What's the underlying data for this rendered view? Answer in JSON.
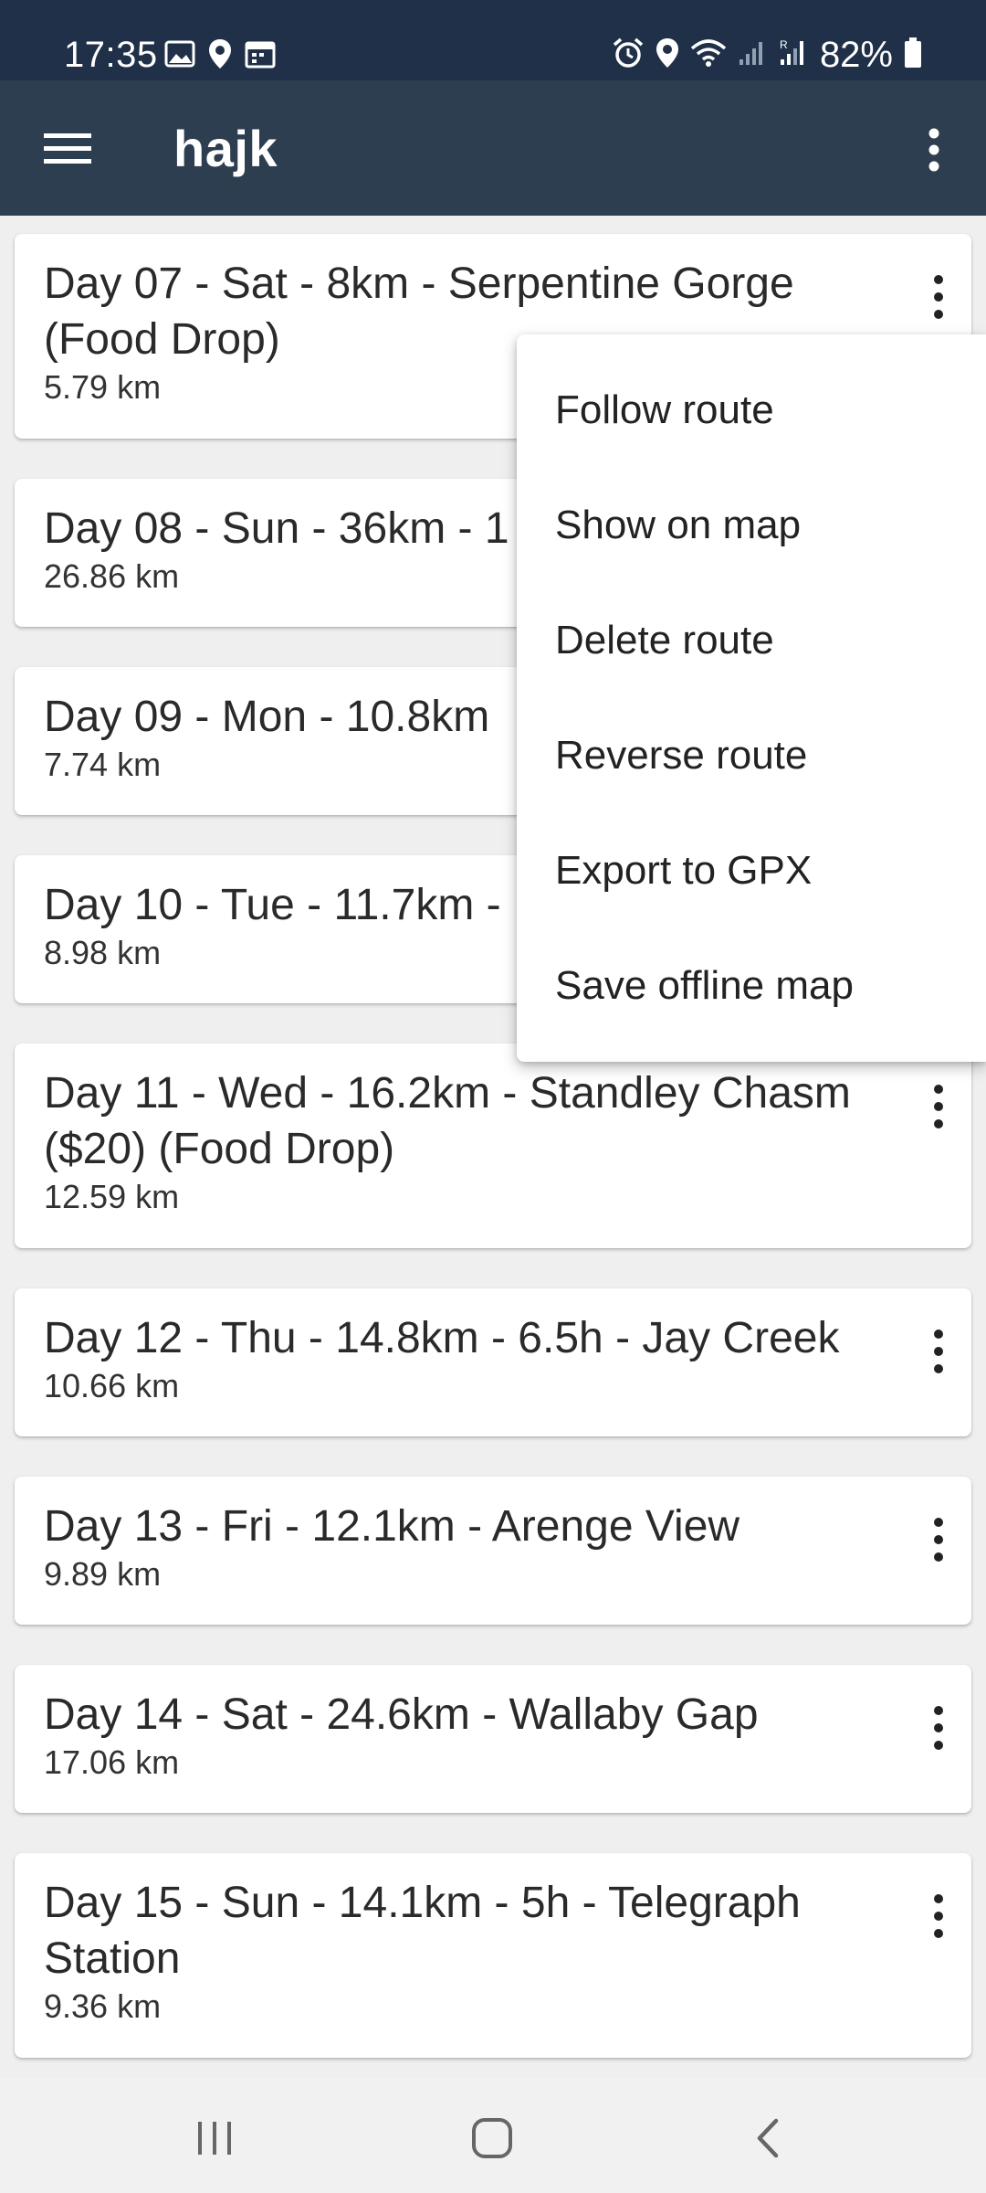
{
  "status_bar": {
    "time": "17:35",
    "battery": "82%",
    "left_icons": [
      "gallery-icon",
      "location-icon",
      "calendar-icon"
    ],
    "right_icons": [
      "alarm-icon",
      "location-icon",
      "wifi-icon",
      "signal-icon",
      "signal-r-icon",
      "battery-icon"
    ]
  },
  "app_bar": {
    "title": "hajk",
    "background": "#2c3e50"
  },
  "routes": [
    {
      "name": "Day 07 - Sat - 8km - Serpentine Gorge (Food Drop)",
      "distance": "5.79 km"
    },
    {
      "name": "Day 08 - Sun - 36km - 1",
      "distance": "26.86 km"
    },
    {
      "name": "Day 09 - Mon - 10.8km",
      "distance": "7.74 km"
    },
    {
      "name": "Day 10 - Tue - 11.7km -",
      "distance": "8.98 km"
    },
    {
      "name": "Day 11 - Wed - 16.2km - Standley Chasm ($20) (Food Drop)",
      "distance": "12.59 km"
    },
    {
      "name": "Day 12 - Thu - 14.8km - 6.5h - Jay Creek",
      "distance": "10.66 km"
    },
    {
      "name": "Day 13  - Fri - 12.1km - Arenge View",
      "distance": "9.89 km"
    },
    {
      "name": "Day 14 - Sat - 24.6km - Wallaby Gap",
      "distance": "17.06 km"
    },
    {
      "name": "Day 15 - Sun - 14.1km - 5h - Telegraph Station",
      "distance": "9.36 km"
    }
  ],
  "popup_menu": {
    "items": [
      "Follow route",
      "Show on map",
      "Delete route",
      "Reverse route",
      "Export to GPX",
      "Save offline map"
    ]
  },
  "nav_bar": {
    "buttons": [
      "recent-apps-icon",
      "home-icon",
      "back-icon"
    ]
  }
}
